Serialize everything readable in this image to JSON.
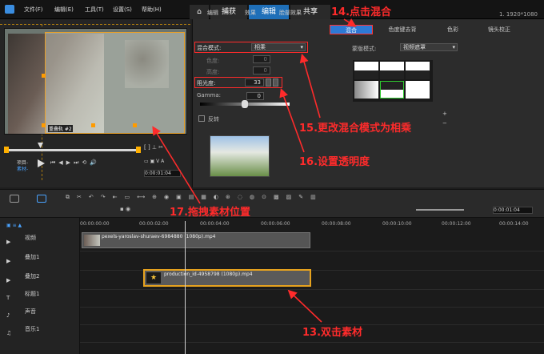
{
  "menu": {
    "file": "文件(F)",
    "edit": "编辑(E)",
    "tools": "工具(T)",
    "settings": "设置(S)",
    "help": "帮助(H)"
  },
  "mode_tabs": {
    "capture": "捕获",
    "edit": "编辑",
    "share": "共享"
  },
  "resolution": "1. 1920*1080",
  "preview": {
    "overlay_label": "重叠轨 #2",
    "project_label": "项目-",
    "clip_label": "素材-"
  },
  "option_tabs": [
    "编辑",
    "效果",
    "脸部效果",
    "混合",
    "色度键去背",
    "色彩",
    "镜头校正"
  ],
  "blend": {
    "mode_label": "混合模式:",
    "mode_value": "相乘",
    "hue_label": "色度:",
    "sat_label": "高度:",
    "opacity_label": "阻光度:",
    "opacity_value": "33",
    "gamma_label": "Gamma:",
    "gamma_value": "0",
    "reverse_label": "反转",
    "mask_mode_label": "蒙版模式:",
    "mask_mode_value": "视频遮罩",
    "zero1": "0",
    "zero2": "0"
  },
  "timeline": {
    "ruler": [
      "00:00:00:00",
      "00:00:02:00",
      "00:00:04:00",
      "00:00:06:00",
      "00:00:08:00",
      "00:00:10:00",
      "00:00:12:00",
      "00:00:14:00"
    ],
    "tracks": [
      "视频",
      "叠加1",
      "叠加2",
      "标题1",
      "声音",
      "音乐1"
    ],
    "clip_video": "pexels-yaroslav-shuraev-6984880 (1080p).mp4",
    "clip_overlay": "production_id-4958798 (1080p).mp4",
    "timecode": "0:00:01:04"
  },
  "annotations": {
    "step14": "14.点击混合",
    "step15": "15.更改混合模式为相乘",
    "step16": "16.设置透明度",
    "step17": "17.拖拽素材位置",
    "step13": "13.双击素材"
  },
  "colors": {
    "accent": "#2d7ad6",
    "annotation": "#ff2b2b",
    "clip_selected": "#e6a21e"
  }
}
